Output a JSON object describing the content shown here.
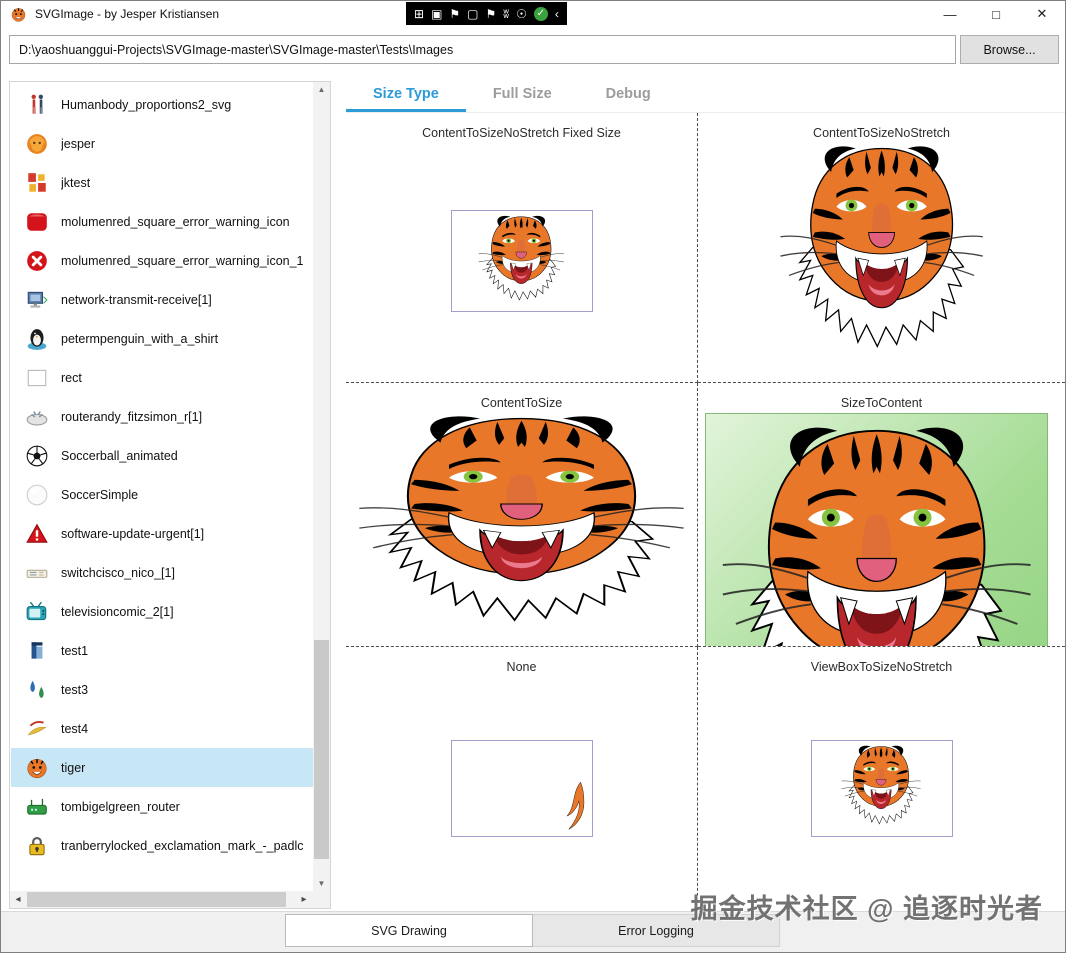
{
  "titlebar": {
    "title": "SVGImage - by Jesper Kristiansen",
    "toolbar_icons": [
      {
        "name": "screen-window-icon",
        "glyph": "⊞"
      },
      {
        "name": "camera-icon",
        "glyph": "▣"
      },
      {
        "name": "flag-icon",
        "glyph": "⚑"
      },
      {
        "name": "frame-icon",
        "glyph": "▢"
      },
      {
        "name": "flag-pole-icon",
        "glyph": "⚑"
      },
      {
        "name": "wifi-icon",
        "glyph": "ʬ"
      },
      {
        "name": "accessibility-icon",
        "glyph": "☉"
      },
      {
        "name": "run-check-icon",
        "glyph": "✓",
        "variant": "check"
      },
      {
        "name": "collapse-left-icon",
        "glyph": "‹"
      }
    ],
    "controls": {
      "minimize": "—",
      "maximize": "□",
      "close": "✕"
    }
  },
  "address": {
    "path": "D:\\yaoshuanggui-Projects\\SVGImage-master\\SVGImage-master\\Tests\\Images",
    "browse_label": "Browse..."
  },
  "file_list": {
    "selected": "tiger",
    "items": [
      {
        "name": "Humanbody_proportions2_svg",
        "icon": "humanbody"
      },
      {
        "name": "jesper",
        "icon": "jesper"
      },
      {
        "name": "jktest",
        "icon": "jktest"
      },
      {
        "name": "molumenred_square_error_warning_icon",
        "icon": "red-square-warning"
      },
      {
        "name": "molumenred_square_error_warning_icon_1",
        "icon": "red-circle-warning"
      },
      {
        "name": "network-transmit-receive[1]",
        "icon": "network"
      },
      {
        "name": "petermpenguin_with_a_shirt",
        "icon": "penguin"
      },
      {
        "name": "rect",
        "icon": "rect"
      },
      {
        "name": "routerandy_fitzsimon_r[1]",
        "icon": "router"
      },
      {
        "name": "Soccerball_animated",
        "icon": "soccerball"
      },
      {
        "name": "SoccerSimple",
        "icon": "soccer-simple"
      },
      {
        "name": "software-update-urgent[1]",
        "icon": "update-urgent"
      },
      {
        "name": "switchcisco_nico_[1]",
        "icon": "switch"
      },
      {
        "name": "televisioncomic_2[1]",
        "icon": "tv"
      },
      {
        "name": "test1",
        "icon": "test1"
      },
      {
        "name": "test3",
        "icon": "test3"
      },
      {
        "name": "test4",
        "icon": "test4"
      },
      {
        "name": "tiger",
        "icon": "tiger",
        "selected": true
      },
      {
        "name": "tombigelgreen_router",
        "icon": "green-router"
      },
      {
        "name": "tranberrylocked_exclamation_mark_-_padlc",
        "icon": "padlock"
      }
    ]
  },
  "tabs": [
    {
      "label": "Size Type",
      "active": true
    },
    {
      "label": "Full Size",
      "active": false
    },
    {
      "label": "Debug",
      "active": false
    }
  ],
  "panels": [
    {
      "title": "ContentToSizeNoStretch Fixed Size",
      "variant": "fixed-box"
    },
    {
      "title": "ContentToSizeNoStretch",
      "variant": "large"
    },
    {
      "title": "ContentToSize",
      "variant": "stretch"
    },
    {
      "title": "SizeToContent",
      "variant": "green"
    },
    {
      "title": "None",
      "variant": "empty-box"
    },
    {
      "title": "ViewBoxToSizeNoStretch",
      "variant": "small-box"
    }
  ],
  "bottom_tabs": [
    {
      "label": "SVG Drawing",
      "active": true
    },
    {
      "label": "Error Logging",
      "active": false
    }
  ],
  "watermark": "掘金技术社区 @ 追逐时光者",
  "colors": {
    "accent": "#2d9bd8",
    "selection": "#c7e6f6",
    "size_to_content_bg": "#8ed07c",
    "render_box_border": "#a99ccd",
    "toolbar_bg": "#000000"
  }
}
